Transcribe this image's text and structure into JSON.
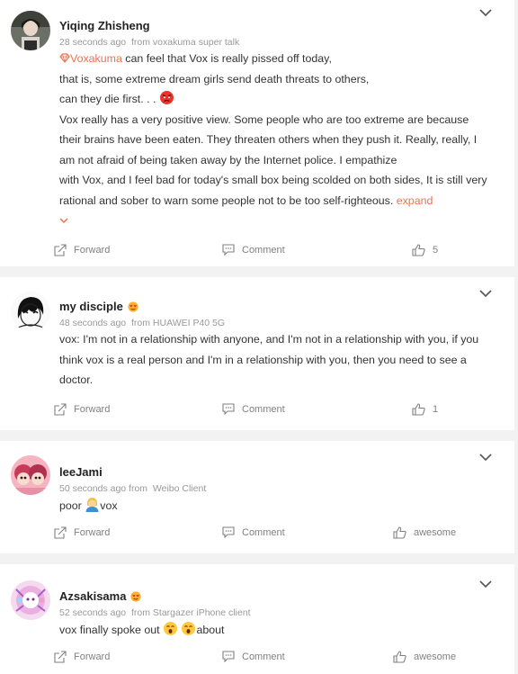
{
  "posts": [
    {
      "name": "Yiqing Zhisheng",
      "time": "28 seconds ago",
      "source": "from voxakuma super talk",
      "mention": "Voxakuma",
      "lines": [
        " can feel that Vox is really pissed off today,",
        "that is, some extreme dream girls send death threats to others,",
        "can they die first. . .",
        "Vox really has a very positive view. Some people who are too extreme are because",
        "their brains have been eaten. They threaten others when they push it. Really, really, I",
        "am not afraid of being taken away by the Internet police. I empathize",
        "with Vox, and I feel bad for today's small box being scolded on both sides, It is still very",
        "rational and sober to warn some people not to be too self-righteous."
      ],
      "expand": "expand",
      "forward": "Forward",
      "comment": "Comment",
      "likes": "5"
    },
    {
      "name": "my disciple",
      "time": "48 seconds ago",
      "source": "from HUAWEI P40 5G",
      "lines": [
        "vox: I'm not in a relationship with anyone, and I'm not in a relationship with you, if you",
        "think vox is a real person and I'm in a relationship with you, then you need to see a",
        "doctor."
      ],
      "forward": "Forward",
      "comment": "Comment",
      "likes": "1"
    },
    {
      "name": "leeJami",
      "time": "50 seconds ago from",
      "source": "Weibo Client",
      "text_a": "poor ",
      "text_b": "vox",
      "forward": "Forward",
      "comment": "Comment",
      "likes": "awesome"
    },
    {
      "name": "Azsakisama",
      "time": "52 seconds ago",
      "source": "from Stargazer iPhone client",
      "text_a": "vox finally spoke out ",
      "text_b": "about",
      "forward": "Forward",
      "comment": "Comment",
      "likes": "awesome"
    }
  ],
  "icons": {
    "chevron": "chevron-down-icon",
    "forward": "share-icon",
    "comment": "comment-icon",
    "like": "thumbs-up-icon"
  },
  "colors": {
    "link": "#eb7350",
    "text": "#333333",
    "meta": "#999999",
    "background": "#f2f2f2"
  }
}
